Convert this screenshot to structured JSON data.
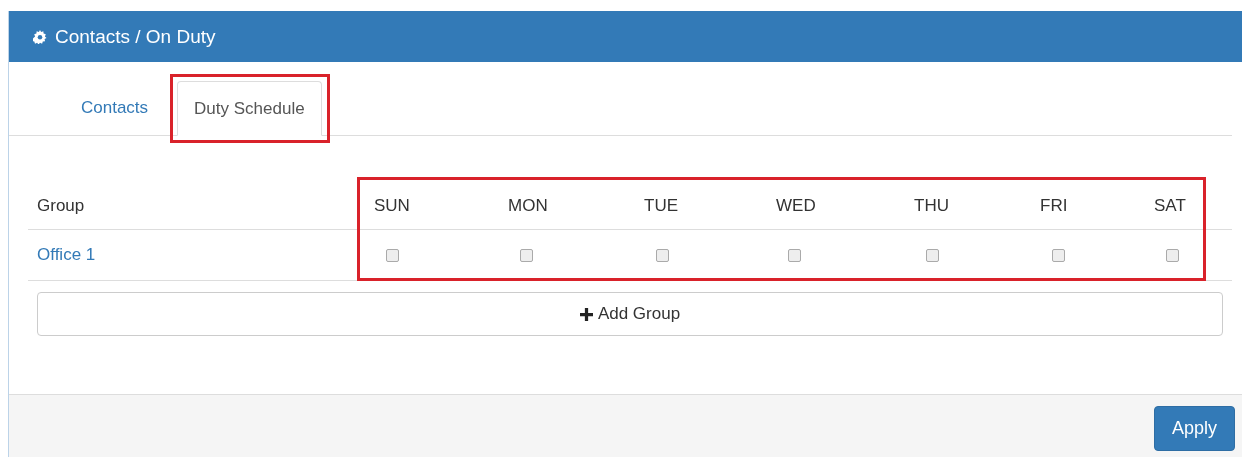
{
  "panel": {
    "title": "Contacts / On Duty"
  },
  "tabs": [
    {
      "label": "Contacts",
      "selected": false,
      "highlighted": false
    },
    {
      "label": "Duty Schedule",
      "selected": true,
      "highlighted": true
    }
  ],
  "schedule": {
    "columns": [
      "Group",
      "SUN",
      "MON",
      "TUE",
      "WED",
      "THU",
      "FRI",
      "SAT"
    ],
    "days_highlighted": true,
    "rows": [
      {
        "group": "Office 1",
        "days": [
          false,
          false,
          false,
          false,
          false,
          false,
          false
        ]
      }
    ]
  },
  "add_button": "Add Group",
  "footer": {
    "button": "Apply"
  }
}
